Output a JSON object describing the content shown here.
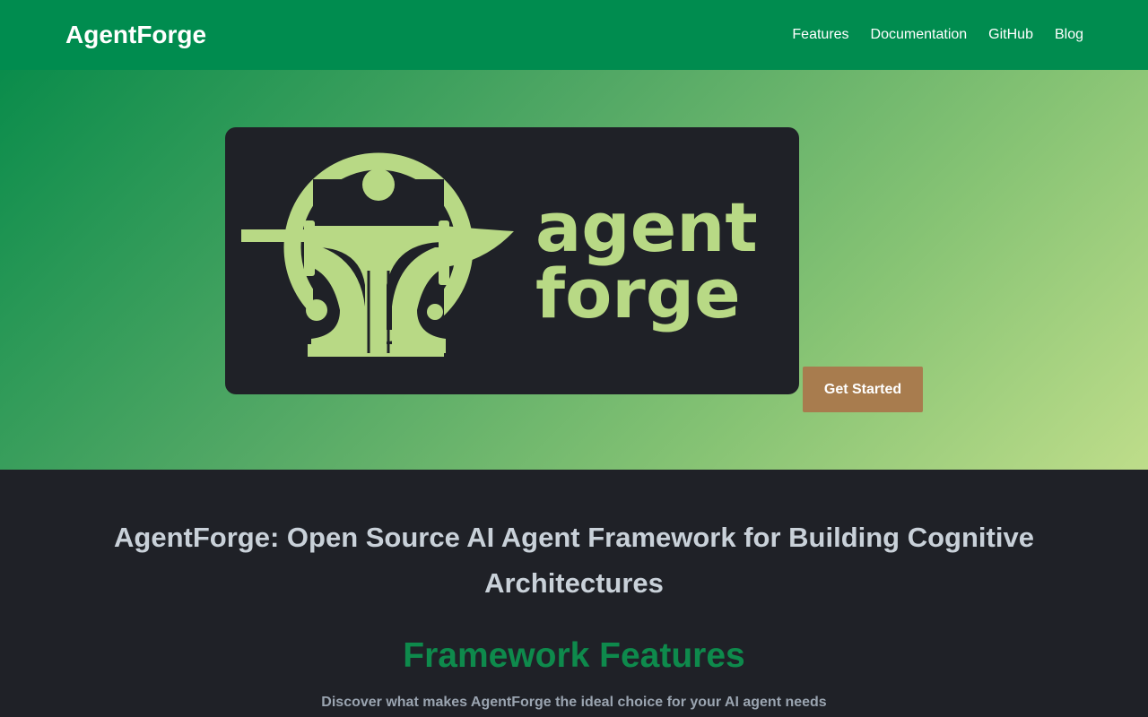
{
  "navbar": {
    "brand": "AgentForge",
    "links": [
      "Features",
      "Documentation",
      "GitHub",
      "Blog"
    ]
  },
  "hero": {
    "logo": {
      "line1": "agent",
      "line2": "forge"
    },
    "cta_label": "Get Started"
  },
  "main": {
    "headline": "AgentForge: Open Source AI Agent Framework for Building Cognitive Architectures",
    "section_title": "Framework Features",
    "section_subtitle": "Discover what makes AgentForge the ideal choice for your AI agent needs"
  },
  "colors": {
    "nav_bg": "#008c4f",
    "logo_green": "#b8d985",
    "card_bg": "#1f2127",
    "cta_bg": "#a87c4e",
    "accent_green": "#0e8a4c"
  }
}
